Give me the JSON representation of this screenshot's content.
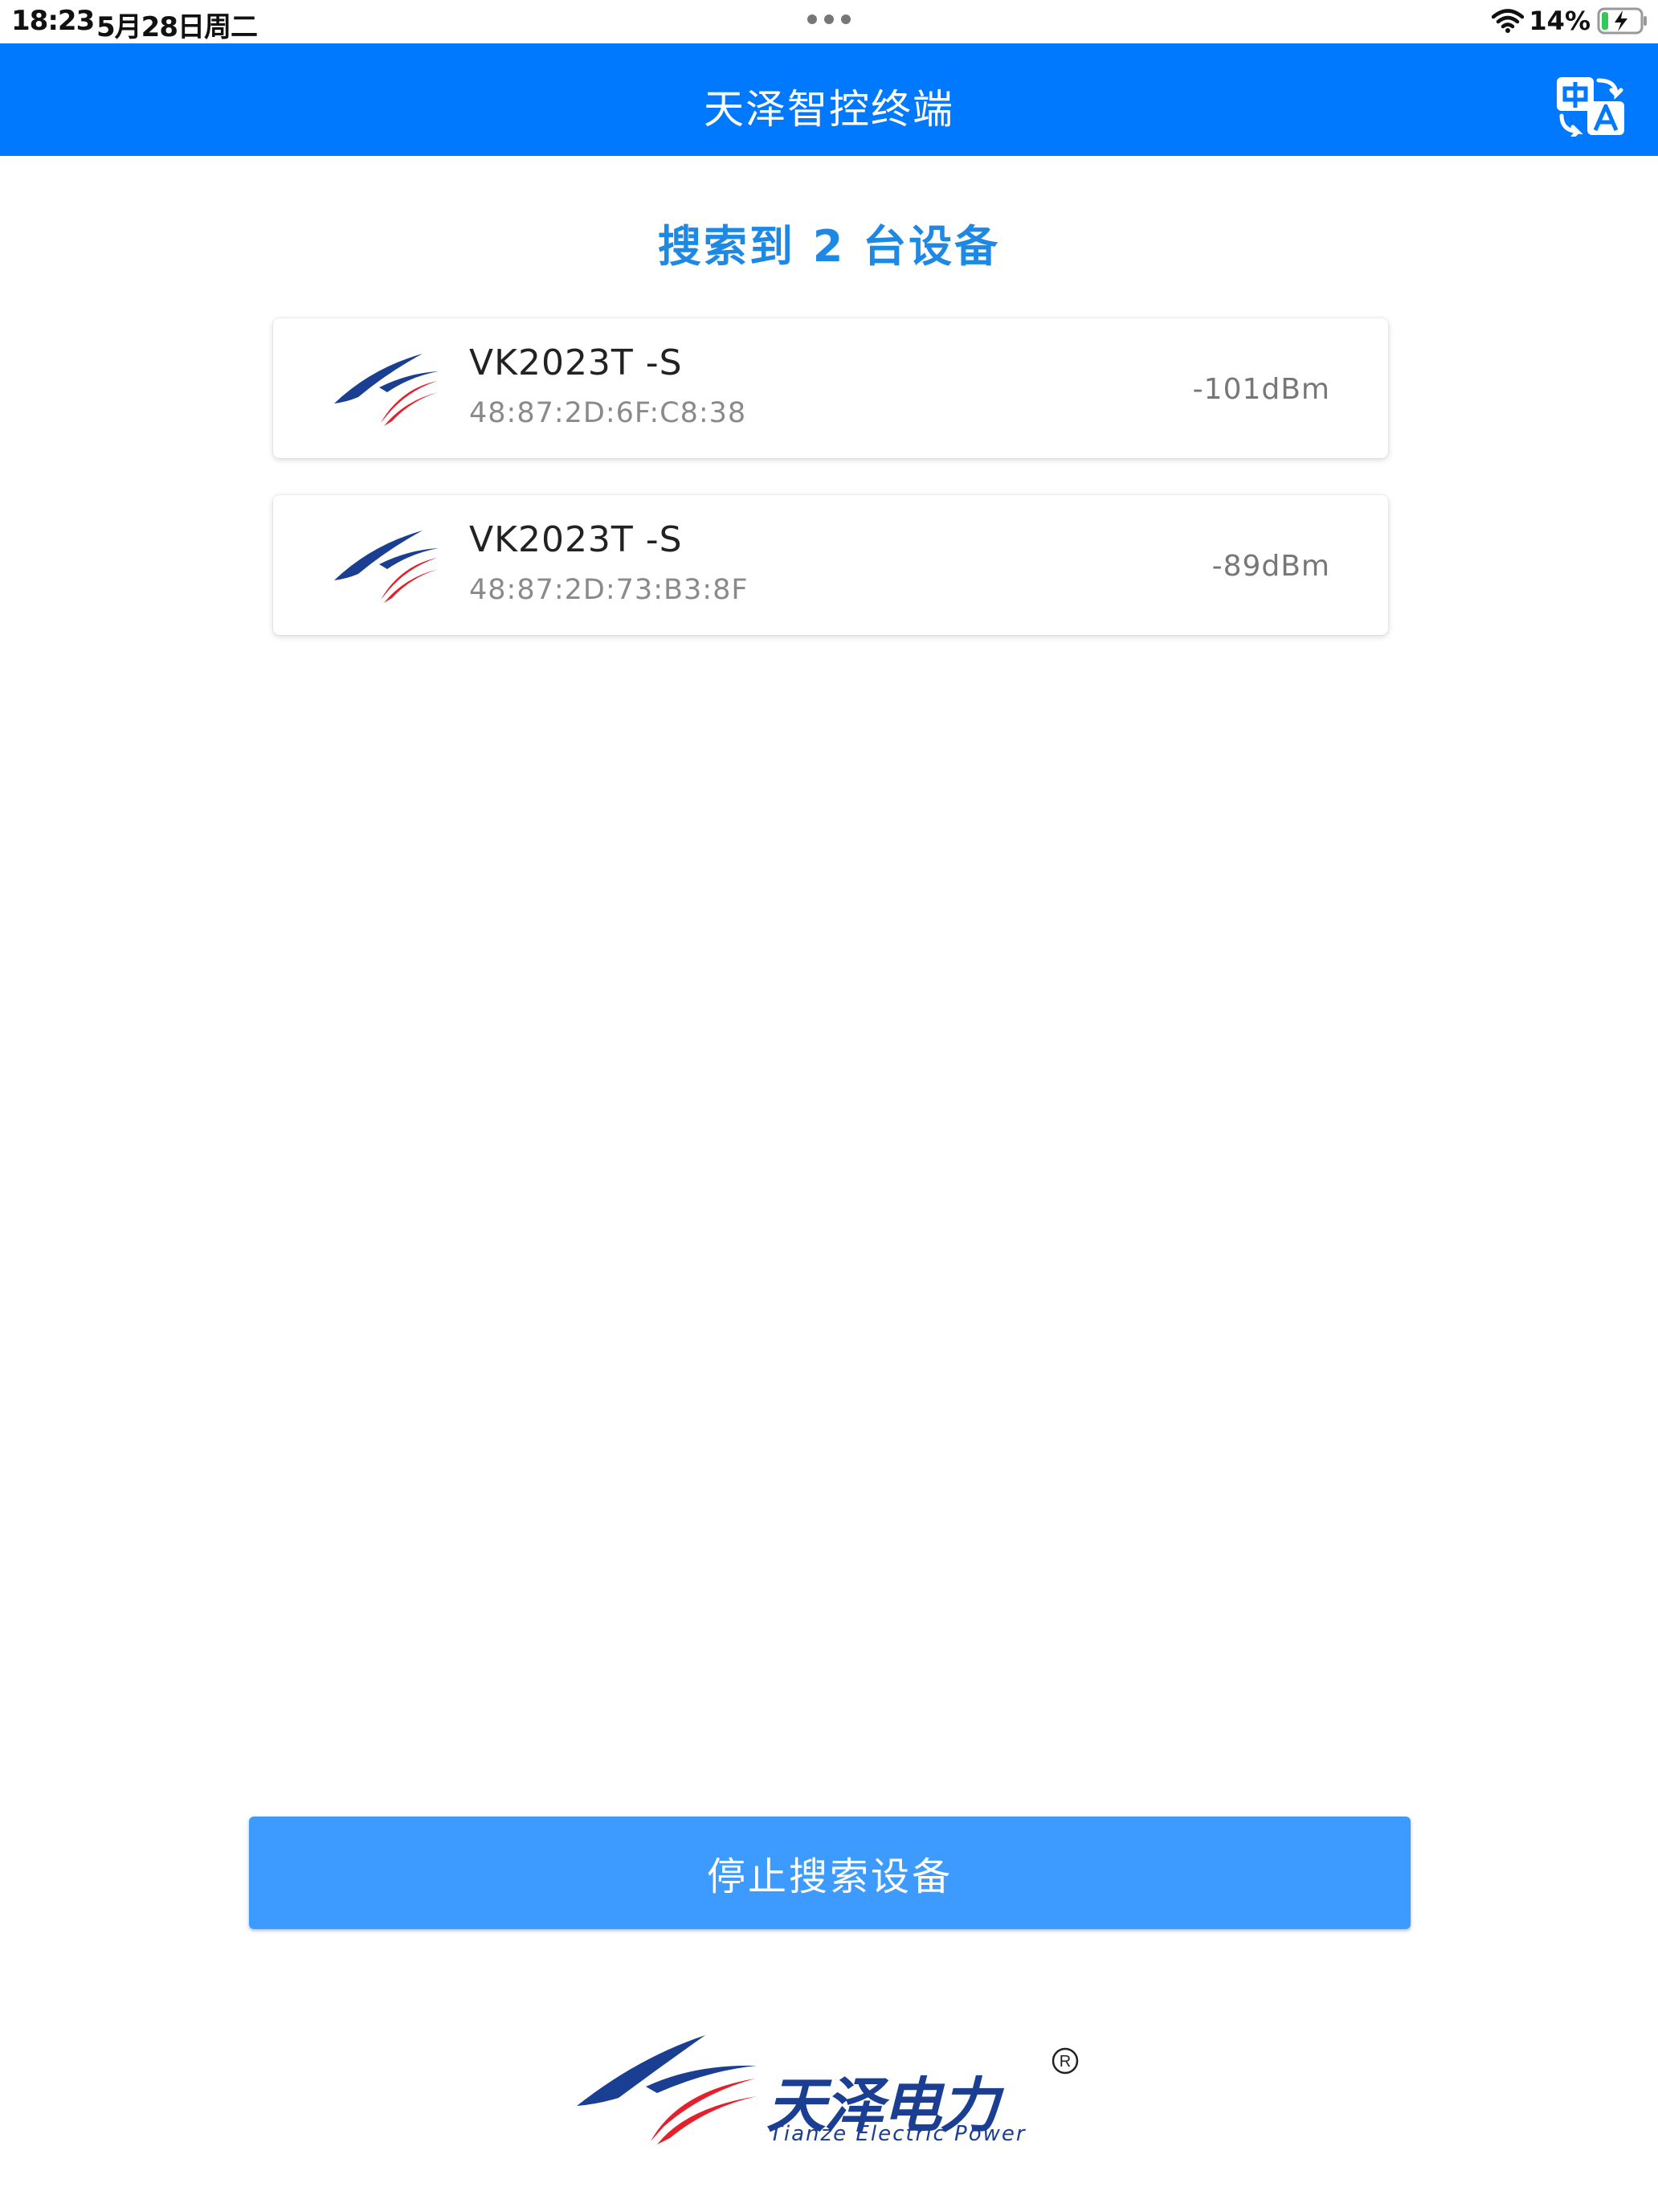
{
  "status_bar": {
    "time": "18:23",
    "date": "5月28日周二",
    "battery_percent": "14%",
    "icons": [
      "wifi-icon",
      "battery-charging-icon",
      "more-dots-icon"
    ]
  },
  "header": {
    "title": "天泽智控终端",
    "translate_icon": "translate-icon"
  },
  "search": {
    "heading": "搜索到 2 台设备"
  },
  "devices": [
    {
      "name": "VK2023T -S",
      "mac": "48:87:2D:6F:C8:38",
      "rssi": "-101dBm",
      "icon": "tianze-logo-icon"
    },
    {
      "name": "VK2023T -S",
      "mac": "48:87:2D:73:B3:8F",
      "rssi": "-89dBm",
      "icon": "tianze-logo-icon"
    }
  ],
  "actions": {
    "stop_search_label": "停止搜索设备"
  },
  "footer": {
    "brand_cn": "天泽电力",
    "brand_en": "Tianze Electric Power",
    "registered": "®"
  },
  "colors": {
    "nav_bar": "#0079ff",
    "heading_text": "#1e88e5",
    "button_bg": "#3d9bff",
    "brand_blue": "#1a3e92",
    "brand_red": "#e4202c"
  }
}
